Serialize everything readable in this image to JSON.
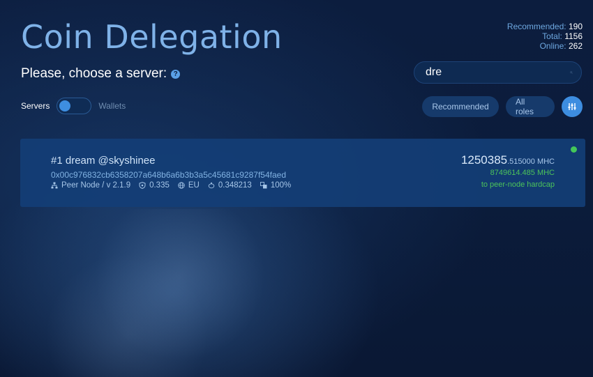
{
  "header": {
    "title": "Coin Delegation",
    "subtitle": "Please, choose a server:"
  },
  "stats": {
    "recommended_label": "Recommended:",
    "recommended_value": "190",
    "total_label": "Total:",
    "total_value": "1156",
    "online_label": "Online:",
    "online_value": "262"
  },
  "search": {
    "value": "dre"
  },
  "toggle": {
    "left_label": "Servers",
    "right_label": "Wallets",
    "state": "Servers"
  },
  "filters": {
    "recommended_label": "Recommended",
    "roles_label": "All roles"
  },
  "servers": [
    {
      "name": "#1 dream @skyshinee",
      "address": "0x00c976832cb6358207a648b6a6b3b3a5c45681c9287f54faed",
      "node_type": "Peer Node / v 2.1.9",
      "trust": "0.335",
      "region": "EU",
      "rate": "0.348213",
      "load": "100%",
      "amount_int": "1250385",
      "amount_dec": ".515000 MHC",
      "remaining": "8749614.485 MHC",
      "remaining_label": "to peer-node hardcap",
      "status": "online"
    }
  ],
  "colors": {
    "accent": "#3d8de0",
    "title": "#7fb2e8",
    "online": "#44c759"
  }
}
